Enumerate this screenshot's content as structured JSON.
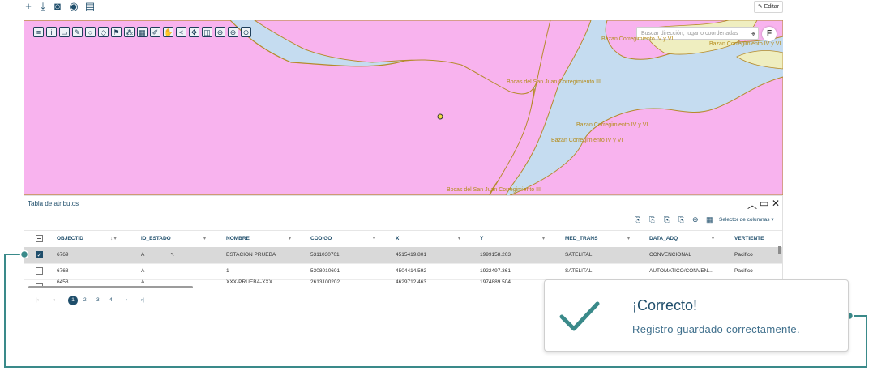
{
  "toolbar": {
    "icons": [
      "plus-icon",
      "download-icon",
      "camera-icon",
      "broadcast-icon",
      "document-icon"
    ],
    "editor_label": "Editar"
  },
  "map": {
    "search_placeholder": "Buscar dirección, lugar o coordenadas",
    "badge": "F",
    "labels": [
      "Bazan Corregimiento IV y VI",
      "Bazan Corregimiento IV y VI",
      "Bocas del San Juan Corregimiento III",
      "Bazan Corregimiento IV y VI",
      "Bazan Corregimiento IV y VI",
      "Bocas del San Juan Corregimiento III"
    ],
    "colors": {
      "water": "#c5dcf0",
      "zone": "#f8b3ee",
      "sand": "#efeec0",
      "border": "#b58a2a"
    }
  },
  "attribute_table": {
    "title": "Tabla de atributos",
    "column_selector": "Selector de columnas",
    "columns": [
      "OBJECTID",
      "ID_ESTADO",
      "NOMBRE",
      "CODIGO",
      "X",
      "Y",
      "MED_TRANS",
      "DATA_ADQ",
      "VERTIENTE"
    ],
    "rows": [
      {
        "checked": true,
        "cells": [
          "6769",
          "A",
          "ESTACION PRUEBA",
          "5311030701",
          "4515419.801",
          "1999158.203",
          "SATELITAL",
          "CONVENCIONAL",
          "Pacifico"
        ]
      },
      {
        "checked": false,
        "cells": [
          "6768",
          "A",
          "1",
          "5308010601",
          "4504414.592",
          "1922497.361",
          "SATELITAL",
          "AUTOMATICO/CONVEN...",
          "Pacifico"
        ]
      },
      {
        "checked": false,
        "cells": [
          "6458",
          "A",
          "XXX-PRUEBA-XXX",
          "2613100202",
          "4629712.463",
          "1974889.504",
          "",
          "",
          ""
        ]
      }
    ],
    "pages": [
      "1",
      "2",
      "3",
      "4"
    ],
    "current_page": "1"
  },
  "toast": {
    "title": "¡Correcto!",
    "message": "Registro guardado correctamente.",
    "accent": "#3a8a8a"
  }
}
